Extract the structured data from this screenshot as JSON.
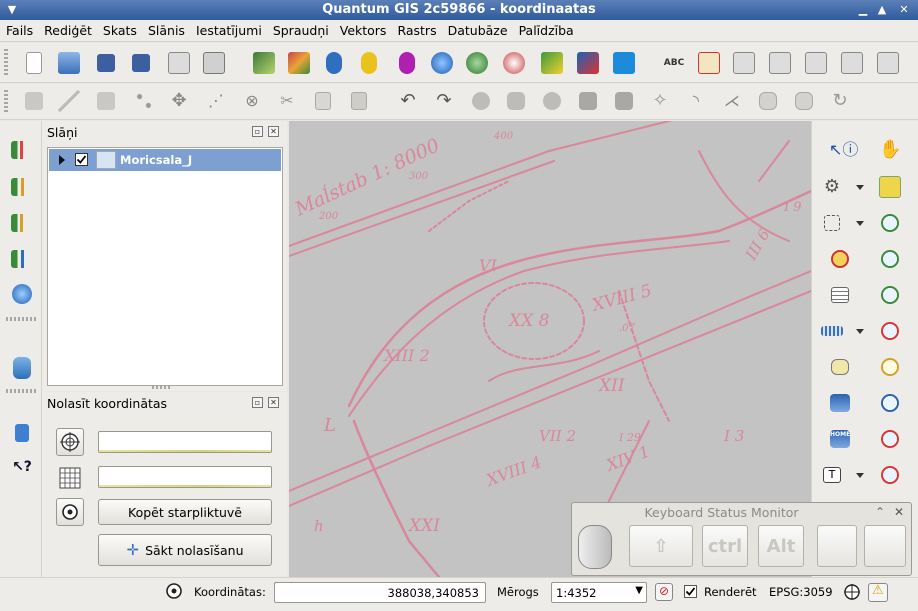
{
  "window": {
    "title": "Quantum GIS 2c59866 - koordinaatas"
  },
  "menu": [
    "Fails",
    "Rediģēt",
    "Skats",
    "Slānis",
    "Iestatījumi",
    "Spraudņi",
    "Vektors",
    "Rastrs",
    "Datubāze",
    "Palīdzība"
  ],
  "layers_panel": {
    "title": "Slāņi",
    "layers": [
      {
        "name": "Moricsala_J",
        "checked": true
      }
    ]
  },
  "coord_panel": {
    "title": "Nolasīt koordinātas",
    "field1_value": "",
    "field2_value": "",
    "copy_button": "Kopēt starpliktuvē",
    "start_button": "Sākt nolasīšanu"
  },
  "map": {
    "labels": [
      "Maĺstab 1: 8000",
      "200",
      "300",
      "400",
      "XVIII 5",
      "XX 8",
      "XIII 2",
      "XII",
      "XVIII 4",
      "XIV 1",
      "XXI",
      "VI",
      "VII 2",
      "I 3",
      "L",
      "h",
      "I 29",
      "III 6",
      "I 9",
      ".07"
    ]
  },
  "keyboard_monitor": {
    "title": "Keyboard Status Monitor",
    "keys": [
      "ctrl",
      "Alt"
    ]
  },
  "status": {
    "coord_label": "Koordinātas:",
    "coord_value": "388038,340853",
    "scale_label": "Mērogs",
    "scale_value": "1:4352",
    "render_label": "Renderēt",
    "render_checked": true,
    "crs": "EPSG:3059"
  },
  "colors": {
    "title_bar": "#2f5a9c",
    "selection": "#7e9fd1",
    "map_lines": "#d9879b",
    "map_bg": "#c3c3c3"
  }
}
